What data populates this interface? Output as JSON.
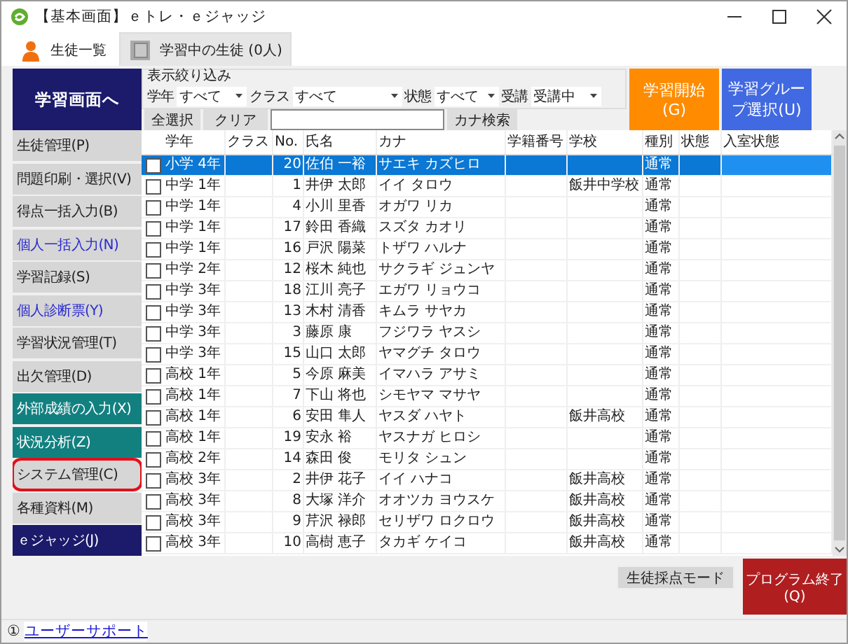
{
  "window": {
    "title": "【基本画面】ｅトレ・ｅジャッジ"
  },
  "tabs": [
    {
      "label": "生徒一覧",
      "selected": true
    },
    {
      "label": "学習中の生徒 (0人)",
      "selected": false
    }
  ],
  "main_button": "学習画面へ",
  "filter": {
    "title": "表示絞り込み",
    "fields": [
      {
        "label": "学年",
        "value": "すべて"
      },
      {
        "label": "クラス",
        "value": "すべて"
      },
      {
        "label": "状態",
        "value": "すべて"
      },
      {
        "label": "受講",
        "value": "受講中"
      }
    ],
    "select_all": "全選択",
    "clear": "クリア",
    "kana_search": "カナ検索"
  },
  "start_button": "学習開始(G)",
  "group_button": "学習グループ選択(U)",
  "sidebar": {
    "items": [
      {
        "label": "生徒管理(P)",
        "kind": "normal",
        "highlighted": false
      },
      {
        "label": "問題印刷・選択(V)",
        "kind": "normal",
        "highlighted": false
      },
      {
        "label": "得点一括入力(B)",
        "kind": "normal",
        "highlighted": false
      },
      {
        "label": "個人一括入力(N)",
        "kind": "link",
        "highlighted": false
      },
      {
        "label": "学習記録(S)",
        "kind": "normal",
        "highlighted": false
      },
      {
        "label": "個人診断票(Y)",
        "kind": "link",
        "highlighted": false
      },
      {
        "label": "学習状況管理(T)",
        "kind": "normal",
        "highlighted": false
      },
      {
        "label": "出欠管理(D)",
        "kind": "normal",
        "highlighted": false
      },
      {
        "label": "外部成績の入力(X)",
        "kind": "teal",
        "highlighted": false
      },
      {
        "label": "状況分析(Z)",
        "kind": "teal",
        "highlighted": false
      },
      {
        "label": "システム管理(C)",
        "kind": "normal",
        "highlighted": true
      },
      {
        "label": "各種資料(M)",
        "kind": "normal",
        "highlighted": false
      },
      {
        "label": "ｅジャッジ(J)",
        "kind": "navy",
        "highlighted": false
      }
    ]
  },
  "table": {
    "columns": [
      "学年",
      "クラス",
      "No.",
      "氏名",
      "カナ",
      "学籍番号",
      "学校",
      "種別",
      "状態",
      "入室状態"
    ],
    "rows": [
      {
        "checked": false,
        "selected": true,
        "cells": [
          "小学 4年",
          null,
          "20",
          "佐伯 一裕",
          "サエキ カズヒロ",
          null,
          null,
          "通常",
          null,
          null
        ]
      },
      {
        "checked": false,
        "selected": false,
        "cells": [
          "中学 1年",
          null,
          "1",
          "井伊 太郎",
          "イイ タロウ",
          null,
          "飯井中学校",
          "通常",
          null,
          null
        ]
      },
      {
        "checked": false,
        "selected": false,
        "cells": [
          "中学 1年",
          null,
          "4",
          "小川 里香",
          "オガワ リカ",
          null,
          null,
          "通常",
          null,
          null
        ]
      },
      {
        "checked": false,
        "selected": false,
        "cells": [
          "中学 1年",
          null,
          "17",
          "鈴田 香織",
          "スズタ カオリ",
          null,
          null,
          "通常",
          null,
          null
        ]
      },
      {
        "checked": false,
        "selected": false,
        "cells": [
          "中学 1年",
          null,
          "16",
          "戸沢 陽菜",
          "トザワ ハルナ",
          null,
          null,
          "通常",
          null,
          null
        ]
      },
      {
        "checked": false,
        "selected": false,
        "cells": [
          "中学 2年",
          null,
          "12",
          "桜木 純也",
          "サクラギ ジュンヤ",
          null,
          null,
          "通常",
          null,
          null
        ]
      },
      {
        "checked": false,
        "selected": false,
        "cells": [
          "中学 3年",
          null,
          "18",
          "江川 亮子",
          "エガワ リョウコ",
          null,
          null,
          "通常",
          null,
          null
        ]
      },
      {
        "checked": false,
        "selected": false,
        "cells": [
          "中学 3年",
          null,
          "13",
          "木村 清香",
          "キムラ サヤカ",
          null,
          null,
          "通常",
          null,
          null
        ]
      },
      {
        "checked": false,
        "selected": false,
        "cells": [
          "中学 3年",
          null,
          "3",
          "藤原 康",
          "フジワラ ヤスシ",
          null,
          null,
          "通常",
          null,
          null
        ]
      },
      {
        "checked": false,
        "selected": false,
        "cells": [
          "中学 3年",
          null,
          "15",
          "山口 太郎",
          "ヤマグチ タロウ",
          null,
          null,
          "通常",
          null,
          null
        ]
      },
      {
        "checked": false,
        "selected": false,
        "cells": [
          "高校 1年",
          null,
          "5",
          "今原 麻美",
          "イマハラ アサミ",
          null,
          null,
          "通常",
          null,
          null
        ]
      },
      {
        "checked": false,
        "selected": false,
        "cells": [
          "高校 1年",
          null,
          "7",
          "下山 将也",
          "シモヤマ マサヤ",
          null,
          null,
          "通常",
          null,
          null
        ]
      },
      {
        "checked": false,
        "selected": false,
        "cells": [
          "高校 1年",
          null,
          "6",
          "安田 隼人",
          "ヤスダ ハヤト",
          null,
          "飯井高校",
          "通常",
          null,
          null
        ]
      },
      {
        "checked": false,
        "selected": false,
        "cells": [
          "高校 1年",
          null,
          "19",
          "安永 裕",
          "ヤスナガ ヒロシ",
          null,
          null,
          "通常",
          null,
          null
        ]
      },
      {
        "checked": false,
        "selected": false,
        "cells": [
          "高校 2年",
          null,
          "14",
          "森田 俊",
          "モリタ シュン",
          null,
          null,
          "通常",
          null,
          null
        ]
      },
      {
        "checked": false,
        "selected": false,
        "cells": [
          "高校 3年",
          null,
          "2",
          "井伊 花子",
          "イイ ハナコ",
          null,
          "飯井高校",
          "通常",
          null,
          null
        ]
      },
      {
        "checked": false,
        "selected": false,
        "cells": [
          "高校 3年",
          null,
          "8",
          "大塚 洋介",
          "オオツカ ヨウスケ",
          null,
          "飯井高校",
          "通常",
          null,
          null
        ]
      },
      {
        "checked": false,
        "selected": false,
        "cells": [
          "高校 3年",
          null,
          "9",
          "芹沢 禄郎",
          "セリザワ ロクロウ",
          null,
          "飯井高校",
          "通常",
          null,
          null
        ]
      },
      {
        "checked": false,
        "selected": false,
        "cells": [
          "高校 3年",
          null,
          "10",
          "高樹 恵子",
          "タカギ ケイコ",
          null,
          "飯井高校",
          "通常",
          null,
          null
        ]
      }
    ]
  },
  "scoring_mode_button": "生徒採点モード",
  "exit_button": "プログラム終了(Q)",
  "status_bar": {
    "icon_text": "①",
    "link": "ユーザーサポート"
  }
}
